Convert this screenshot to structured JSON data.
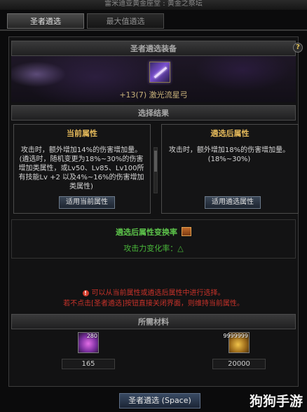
{
  "window": {
    "title": "雷米迪亚黄金座堂 : 黄金之祭坛"
  },
  "tabs": [
    {
      "label": "圣者遴选",
      "active": true
    },
    {
      "label": "最大值遴选",
      "active": false
    }
  ],
  "equipment": {
    "header": "圣者遴选装备",
    "item_name": "+13(7) 激光流星弓",
    "help_icon": "?"
  },
  "selection": {
    "header": "选择结果",
    "current": {
      "title": "当前属性",
      "text": "攻击时，额外增加14%的伤害增加量。(遴选时，随机变更为18%~30%的伤害增加类属性，或Lv50、Lv85、Lv100所有技能Lv +2 以及4%~16%的伤害增加类属性)",
      "button": "适用当前属性"
    },
    "after": {
      "title": "遴选后属性",
      "text": "攻击时，额外增加18%的伤害增加量。(18%~30%)",
      "button": "适用遴选属性"
    }
  },
  "conversion": {
    "title": "遴选后属性变换率",
    "change_label": "攻击力变化率：△"
  },
  "notices": [
    "可以从当前属性或遴选后属性中进行选择。",
    "若不点击[圣者遴选]按钮直接关闭界面，则维持当前属性。"
  ],
  "materials": {
    "header": "所需材料",
    "items": [
      {
        "icon": "crystal-icon",
        "count": "280",
        "value": "165"
      },
      {
        "icon": "gold-icon",
        "count": "9999999",
        "value": "20000"
      }
    ]
  },
  "action": {
    "main_button": "圣者遴选 (Space)"
  },
  "watermark": "狗狗手游"
}
